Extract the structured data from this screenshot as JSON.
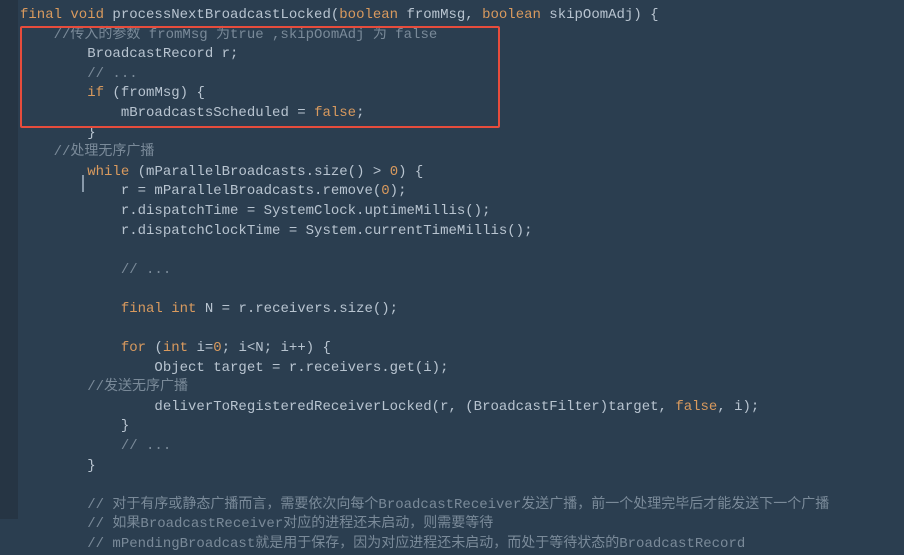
{
  "code": {
    "l1_prefix": "final void ",
    "l1_fn": "processNextBroadcastLocked",
    "l1_p1": "(",
    "l1_t1": "boolean",
    "l1_a1": " fromMsg, ",
    "l1_t2": "boolean",
    "l1_a2": " skipOomAdj) {",
    "l2": "    //传入的参数 fromMsg 为true ,skipOomAdj 为 false",
    "l3": "        BroadcastRecord r;",
    "l4": "        // ...",
    "l5a": "        ",
    "l5_if": "if",
    "l5b": " (fromMsg) {",
    "l6a": "            mBroadcastsScheduled = ",
    "l6_false": "false",
    "l6b": ";",
    "l7": "        }",
    "l8": "    //处理无序广播",
    "l9a": "        ",
    "l9_while": "while",
    "l9b": " (mParallelBroadcasts.size() > ",
    "l9_0": "0",
    "l9c": ") {",
    "l10a": "            r = mParallelBroadcasts.remove(",
    "l10_0": "0",
    "l10b": ");",
    "l11": "            r.dispatchTime = SystemClock.uptimeMillis();",
    "l12": "            r.dispatchClockTime = System.currentTimeMillis();",
    "l13": "",
    "l14": "            // ...",
    "l15": "",
    "l16a": "            ",
    "l16_final": "final int",
    "l16b": " N = r.receivers.size();",
    "l17": "",
    "l18a": "            ",
    "l18_for": "for",
    "l18b": " (",
    "l18_int": "int",
    "l18c": " i=",
    "l18_0": "0",
    "l18d": "; i<N; i++) {",
    "l19": "                Object target = r.receivers.get(i);",
    "l20": "        //发送无序广播",
    "l21a": "                deliverToRegisteredReceiverLocked(r, (BroadcastFilter)target, ",
    "l21_false": "false",
    "l21b": ", i);",
    "l22": "            }",
    "l23": "            // ...",
    "l24": "        }",
    "l25": "",
    "l26": "        // 对于有序或静态广播而言，需要依次向每个BroadcastReceiver发送广播，前一个处理完毕后才能发送下一个广播",
    "l27": "        // 如果BroadcastReceiver对应的进程还未启动，则需要等待",
    "l28": "        // mPendingBroadcast就是用于保存，因为对应进程还未启动，而处于等待状态的BroadcastRecord"
  }
}
